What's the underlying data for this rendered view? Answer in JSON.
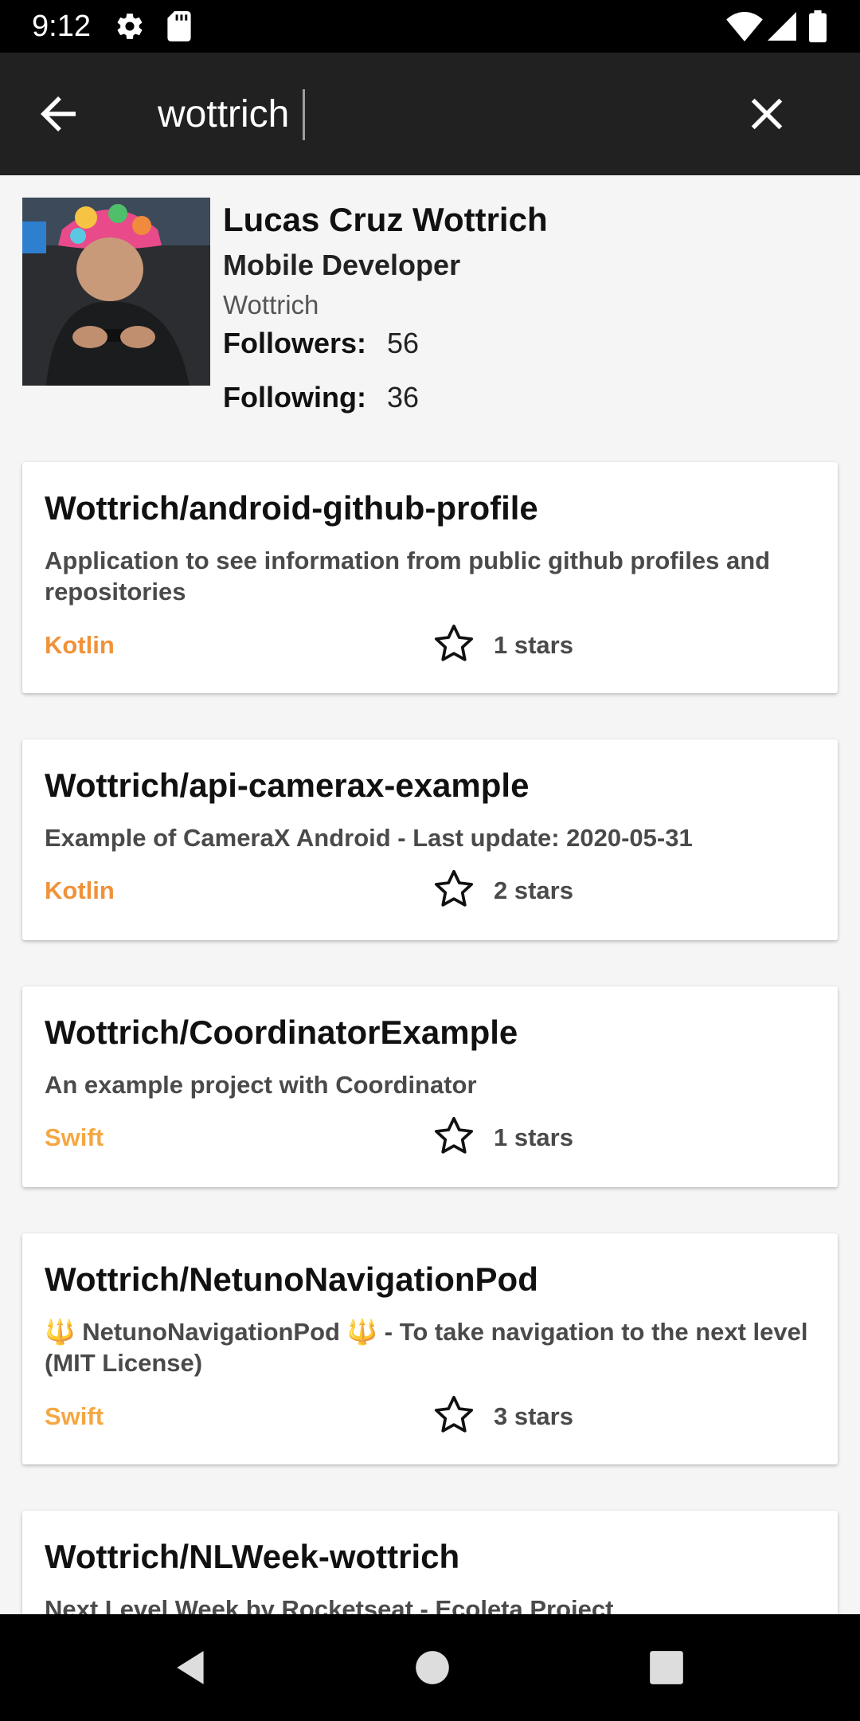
{
  "status_bar": {
    "time": "9:12",
    "icons": [
      "gear-icon",
      "sd-card-icon",
      "wifi-icon",
      "signal-icon",
      "battery-icon"
    ]
  },
  "search": {
    "query": "wottrich",
    "back_icon": "arrow-back-icon",
    "clear_icon": "close-icon"
  },
  "profile": {
    "name": "Lucas Cruz Wottrich",
    "title": "Mobile Developer",
    "login": "Wottrich",
    "followers_label": "Followers:",
    "followers": "56",
    "following_label": "Following:",
    "following": "36"
  },
  "repos": [
    {
      "name": "Wottrich/android-github-profile",
      "description": "Application to see information from public github profiles and repositories",
      "language": "Kotlin",
      "stars": "1 stars"
    },
    {
      "name": "Wottrich/api-camerax-example",
      "description": "Example of CameraX Android - Last update: 2020-05-31",
      "language": "Kotlin",
      "stars": "2 stars"
    },
    {
      "name": "Wottrich/CoordinatorExample",
      "description": "An example project with Coordinator",
      "language": "Swift",
      "stars": "1 stars"
    },
    {
      "name": "Wottrich/NetunoNavigationPod",
      "description": "🔱 NetunoNavigationPod 🔱 - To take navigation to the next level (MIT License)",
      "language": "Swift",
      "stars": "3 stars"
    },
    {
      "name": "Wottrich/NLWeek-wottrich",
      "description": "Next Level Week by Rocketseat - Ecoleta Project",
      "language": "",
      "stars": ""
    }
  ],
  "colors": {
    "kotlin": "#F0923A",
    "swift": "#F5A742",
    "app_bar": "#212121",
    "background": "#F5F5F5"
  },
  "nav_bar": {
    "icons": [
      "nav-back-icon",
      "nav-home-icon",
      "nav-recents-icon"
    ]
  }
}
